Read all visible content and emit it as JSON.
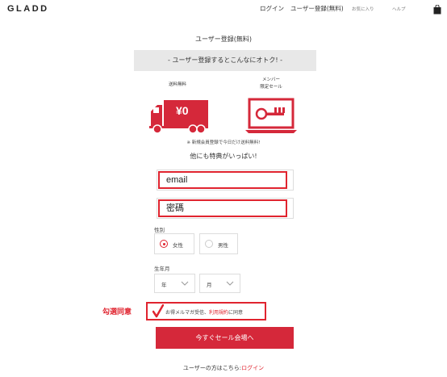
{
  "header": {
    "logo": "GLADD",
    "nav": [
      "ログイン",
      "ユーザー登録(無料)",
      "お気に入り",
      "ヘルプ"
    ],
    "cart_icon": "shopping-bag-icon"
  },
  "page": {
    "title": "ユーザー登録(無料)",
    "banner": "- ユーザー登録するとこんなにオトク! -",
    "benefits": [
      {
        "caption": "送料無料",
        "icon": "delivery-truck-icon",
        "truck_text": "¥0"
      },
      {
        "caption_line1": "メンバー",
        "caption_line2": "限定セール",
        "icon": "laptop-key-icon"
      }
    ],
    "note": "※ 新規会員登録で今日だけ送料無料!",
    "more_benefits": "他にも特典がいっぱい!"
  },
  "form": {
    "email_value": "email",
    "password_value": "密碼",
    "gender_label": "性別",
    "gender_options": [
      {
        "label": "女性",
        "selected": true
      },
      {
        "label": "男性",
        "selected": false
      }
    ],
    "birth_label": "生年月",
    "year_select": "年",
    "month_select": "月",
    "consent_prefix": "お得メルマガ受信、",
    "consent_link": "利用規約",
    "consent_suffix": "に同意",
    "consent_checked": true,
    "annotation": "勾選同意",
    "submit_label": "今すぐセール会場へ"
  },
  "footer": {
    "prefix": "ユーザーの方はこちら:",
    "login_link": "ログイン"
  },
  "colors": {
    "accent": "#e0242f",
    "button": "#d5283a",
    "banner_bg": "#e8e8e8"
  }
}
